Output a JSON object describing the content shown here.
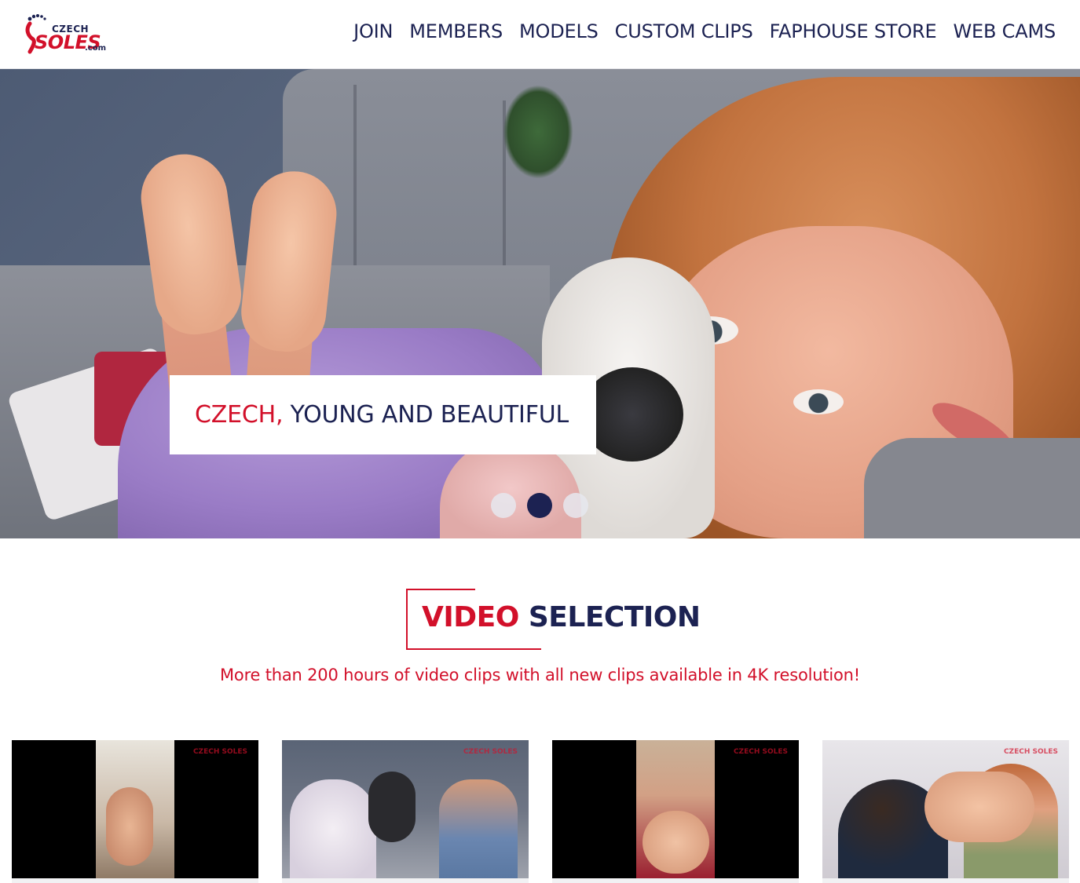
{
  "brand": {
    "logo_small": "CZECH",
    "logo_big": "SOLES",
    "logo_suffix": ".com"
  },
  "nav": {
    "items": [
      {
        "label": "JOIN"
      },
      {
        "label": "MEMBERS"
      },
      {
        "label": "MODELS"
      },
      {
        "label": "CUSTOM CLIPS"
      },
      {
        "label": "FAPHOUSE STORE"
      },
      {
        "label": "WEB CAMS"
      }
    ]
  },
  "hero": {
    "caption_highlight": "CZECH,",
    "caption_rest": " YOUNG AND BEAUTIFUL",
    "carousel": {
      "total": 3,
      "active_index": 1
    }
  },
  "section": {
    "title_highlight": "VIDEO",
    "title_rest": " SELECTION",
    "subtitle": "More than 200 hours of video clips with all new clips available in 4K resolution!"
  },
  "thumbnails": [
    {
      "watermark": "CZECH SOLES"
    },
    {
      "watermark": "CZECH SOLES"
    },
    {
      "watermark": "CZECH SOLES"
    },
    {
      "watermark": "CZECH SOLES"
    }
  ],
  "colors": {
    "accent_red": "#d2102a",
    "navy": "#1c2252",
    "background": "#ffffff"
  }
}
